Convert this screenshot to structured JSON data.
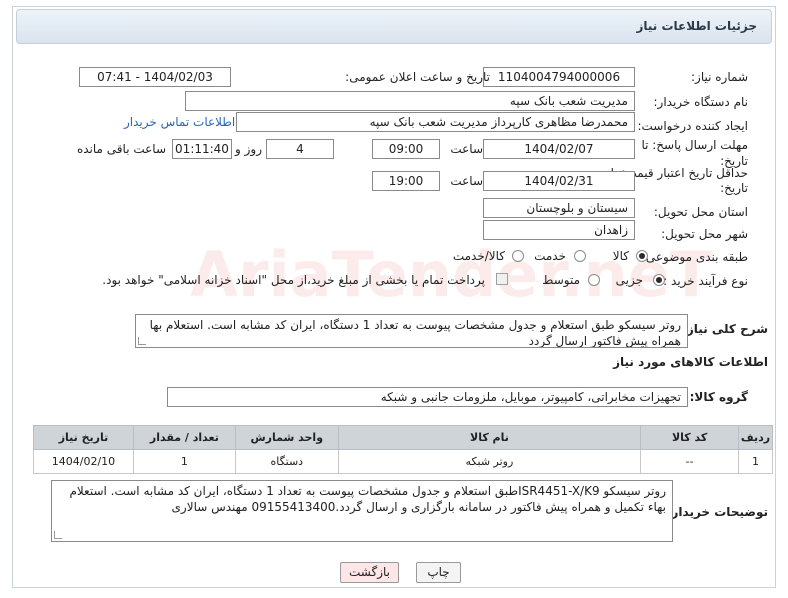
{
  "page_title": "جزئیات اطلاعات نیاز",
  "fields": {
    "need_number_label": "شماره نیاز:",
    "need_number": "1104004794000006",
    "announce_label": "تاریخ و ساعت اعلان عمومی:",
    "announce_value": "1404/02/03 - 07:41",
    "buyer_org_label": "نام دستگاه خریدار:",
    "buyer_org": "مدیریت شعب بانک سپه",
    "requester_label": "ایجاد کننده درخواست:",
    "requester": "محمدرضا مظاهری کارپرداز مدیریت شعب بانک سپه",
    "contact_link": "اطلاعات تماس خریدار",
    "reply_deadline_label": "مهلت ارسال پاسخ: تا تاریخ:",
    "reply_date": "1404/02/07",
    "hour_label": "ساعت",
    "reply_time": "09:00",
    "days_value": "4",
    "days_label": "روز و",
    "remaining_time": "01:11:40",
    "remaining_label": "ساعت باقی مانده",
    "price_validity_label": "حداقل تاریخ اعتبار قیمت: تا تاریخ:",
    "price_date": "1404/02/31",
    "price_time": "19:00",
    "province_label": "استان محل تحویل:",
    "province": "سیستان و بلوچستان",
    "city_label": "شهر محل تحویل:",
    "city": "زاهدان",
    "category_label": "طبقه بندی موضوعی:",
    "category_options": [
      "کالا",
      "خدمت",
      "کالا/خدمت"
    ],
    "process_label": "نوع فرآیند خرید :",
    "process_options": [
      "جزیی",
      "متوسط"
    ],
    "payment_note": "پرداخت تمام یا بخشی از مبلغ خرید،از محل \"اسناد خزانه اسلامی\" خواهد بود."
  },
  "general_desc": {
    "label": "شرح کلی نیاز:",
    "text": "روتر سیسکو طبق استعلام و جدول مشخصات پیوست به تعداد 1 دستگاه، ایران کد مشابه است. استعلام بها همراه پیش فاکتور ارسال گردد"
  },
  "goods_section": {
    "title": "اطلاعات کالاهای مورد نیاز",
    "group_label": "گروه کالا:",
    "group_value": "تجهیزات مخابراتی، کامپیوتر، موبایل، ملزومات جانبی و شبکه"
  },
  "table": {
    "headers": [
      "ردیف",
      "کد کالا",
      "نام کالا",
      "واحد شمارش",
      "تعداد / مقدار",
      "تاریخ نیاز"
    ],
    "rows": [
      [
        "1",
        "--",
        "روتر شبکه",
        "دستگاه",
        "1",
        "1404/02/10"
      ]
    ]
  },
  "buyer_notes": {
    "label": "توضیحات خریدار:",
    "text": "روتر سیسکو ISR4451-X/K9طبق استعلام و جدول مشخصات پیوست به تعداد 1 دستگاه، ایران کد مشابه است. استعلام بهاء تکمیل و همراه پیش فاکتور در سامانه بارگزاری و ارسال گردد.09155413400 مهندس سالاری"
  },
  "buttons": {
    "print": "چاپ",
    "back": "بازگشت"
  },
  "watermark": "AriaTender.neT",
  "colors": {
    "back_button_bg": "#fde6e8",
    "table_header_bg": "#cfd4d9",
    "link": "#2a66b5"
  }
}
